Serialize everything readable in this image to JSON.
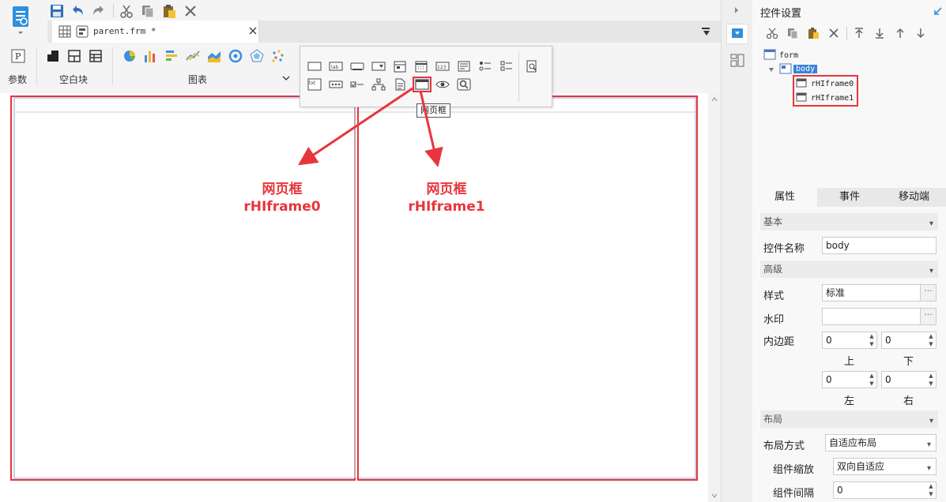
{
  "toolbar": {
    "save_icon": "save-icon",
    "undo_icon": "undo-icon",
    "redo_icon": "redo-icon",
    "cut_icon": "cut-icon",
    "copy_icon": "copy-icon",
    "paste_icon": "paste-icon",
    "delete_icon": "delete-icon"
  },
  "document_tab": {
    "name": "parent.frm *"
  },
  "ribbon": {
    "groups": [
      {
        "label": "参数"
      },
      {
        "label": "空白块"
      },
      {
        "label": "图表"
      }
    ]
  },
  "palette": {
    "row1": [
      "text-box",
      "label-lab",
      "button",
      "combo-box",
      "date-picker",
      "calendar",
      "number-123",
      "text-area",
      "radio-group",
      "checkbox-group",
      "preview"
    ],
    "row2": [
      "txt-field",
      "password",
      "checkbox",
      "tree",
      "file",
      "webpage-frame",
      "view",
      "search"
    ],
    "tooltip": "网页框"
  },
  "canvas": {
    "annotations": [
      {
        "title": "网页框",
        "subtitle": "rHIframe0"
      },
      {
        "title": "网页框",
        "subtitle": "rHIframe1"
      }
    ],
    "accent": "#e8353c"
  },
  "panel": {
    "title": "控件设置",
    "tree": {
      "root": "form",
      "body": "body",
      "children": [
        "rHIframe0",
        "rHIframe1"
      ]
    },
    "tabs": [
      "属性",
      "事件",
      "移动端"
    ],
    "sections": {
      "basic": "基本",
      "advanced": "高级",
      "layout": "布局"
    },
    "name_label": "控件名称",
    "name_value": "body",
    "style_label": "样式",
    "style_value": "标准",
    "watermark_label": "水印",
    "watermark_value": "",
    "padding_label": "内边距",
    "padding": {
      "top": "0",
      "bottom": "0",
      "left": "0",
      "right": "0"
    },
    "padding_sides": {
      "top": "上",
      "bottom": "下",
      "left": "左",
      "right": "右"
    },
    "layout_mode_label": "布局方式",
    "layout_mode_value": "自适应布局",
    "scale_label": "组件缩放",
    "scale_value": "双向自适应",
    "gap_label": "组件间隔",
    "gap_value": "0"
  },
  "colors": {
    "brand": "#2f8fdd",
    "accent": "#e8353c",
    "selection": "#3b82d6"
  }
}
